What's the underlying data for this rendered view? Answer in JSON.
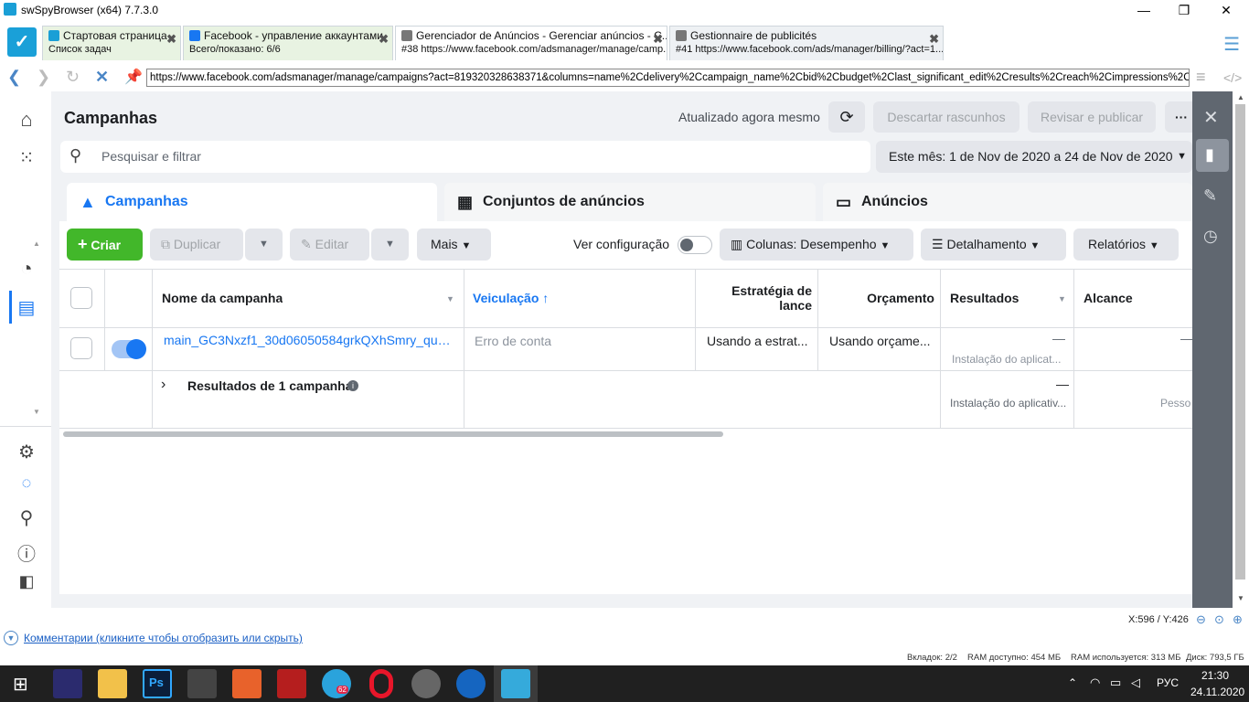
{
  "window": {
    "title": "swSpyBrowser (x64) 7.7.3.0",
    "minimize": "—",
    "restore": "❐",
    "close": "✕"
  },
  "tabs": [
    {
      "line1": "Стартовая страница",
      "line2": "Список задач",
      "fav": "#1a9fd6"
    },
    {
      "line1": "Facebook - управление аккаунтами",
      "line2": "Всего/показано: 6/6",
      "fav": "#1877f2"
    },
    {
      "line1": "Gerenciador de Anúncios - Gerenciar anúncios - C...",
      "line2": "#38 https://www.facebook.com/adsmanager/manage/camp...",
      "fav": "#777"
    },
    {
      "line1": "Gestionnaire de publicités",
      "line2": "#41 https://www.facebook.com/ads/manager/billing/?act=1...",
      "fav": "#777"
    }
  ],
  "tab_close": "✖",
  "url": "https://www.facebook.com/adsmanager/manage/campaigns?act=819320328638371&columns=name%2Cdelivery%2Ccampaign_name%2Cbid%2Cbudget%2Clast_significant_edit%2Cresults%2Creach%2Cimpressions%2Ccost_per_",
  "header": {
    "title": "Campanhas",
    "updated": "Atualizado agora mesmo",
    "discard": "Descartar rascunhos",
    "review": "Revisar e publicar",
    "more": "···"
  },
  "search": {
    "placeholder": "Pesquisar e filtrar"
  },
  "date_range": "Este mês: 1 de Nov de 2020 a 24 de Nov de 2020",
  "entity_tabs": {
    "campaigns": "Campanhas",
    "adsets": "Conjuntos de anúncios",
    "ads": "Anúncios"
  },
  "toolbar": {
    "create": "Criar",
    "duplicate": "Duplicar",
    "edit": "Editar",
    "more": "Mais",
    "view_config": "Ver configuração",
    "columns": "Colunas: Desempenho",
    "breakdown": "Detalhamento",
    "reports": "Relatórios"
  },
  "table": {
    "headers": {
      "name": "Nome da campanha",
      "delivery": "Veiculação",
      "bid_strategy": "Estratégia de lance",
      "budget": "Orçamento",
      "results": "Resultados",
      "reach": "Alcance"
    },
    "row": {
      "name": "main_GC3Nxzf1_30d06050584grkQXhSmry_qua...",
      "delivery": "Erro de conta",
      "bid": "Usando a estrat...",
      "budget": "Usando orçame...",
      "results_value": "—",
      "results_sub": "Instalação do aplicat...",
      "reach": "—"
    },
    "summary": {
      "label": "Resultados de 1 campanha",
      "results_value": "—",
      "results_sub": "Instalação do aplicativ...",
      "reach_sub": "Pesso"
    }
  },
  "status": {
    "coords": "X:596 / Y:426",
    "comments": "Комментарии (кликните чтобы отобразить или скрыть)",
    "tabs": "Вкладок: 2/2",
    "ram_free": "RAM доступно: 454 МБ",
    "ram_used": "RAM используется: 313 МБ",
    "disk": "Диск: 793,5 ГБ"
  },
  "taskbar": {
    "time": "21:30",
    "date": "24.11.2020",
    "lang": "РУС",
    "badge": "62"
  }
}
